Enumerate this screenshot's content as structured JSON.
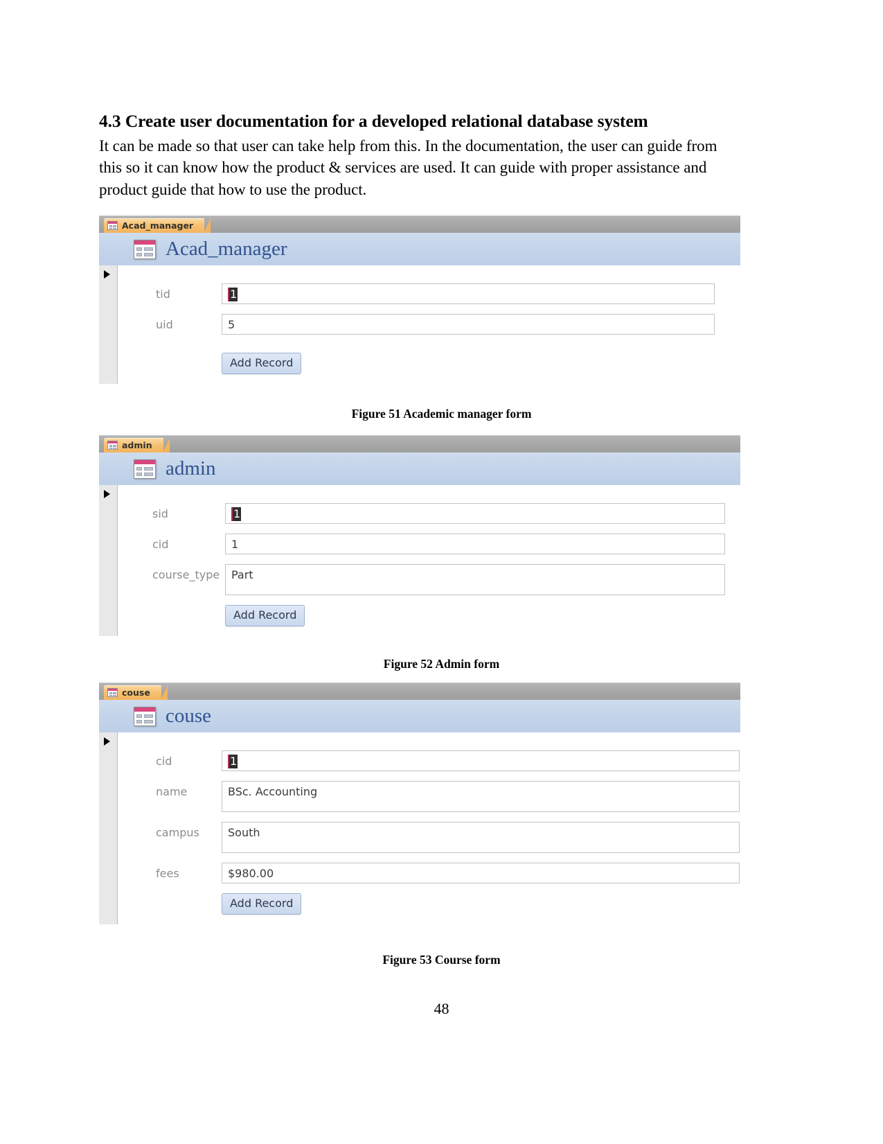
{
  "document": {
    "section_heading": "4.3 Create user documentation for a developed relational database system",
    "paragraph": "It can be made so that user can take help from this. In the documentation, the user can guide from this so it can know how the product & services are used. It can guide with proper assistance and product guide that how to use the product.",
    "page_number": "48"
  },
  "figures": [
    {
      "caption": "Figure 51 Academic manager form",
      "screenshot": {
        "tab_label": "Acad_manager",
        "tab_icon": "form-icon",
        "header_title": "Acad_manager",
        "header_icon": "form-icon",
        "record_selector_icon": "current-record-arrow-icon",
        "fields": [
          {
            "label": "tid",
            "value": "1",
            "selected": true
          },
          {
            "label": "uid",
            "value": "5",
            "selected": false
          }
        ],
        "button_label": "Add Record"
      }
    },
    {
      "caption": "Figure 52 Admin form",
      "screenshot": {
        "tab_label": "admin",
        "tab_icon": "form-icon",
        "header_title": "admin",
        "header_icon": "form-icon",
        "record_selector_icon": "current-record-arrow-icon",
        "fields": [
          {
            "label": "sid",
            "value": "1",
            "selected": true
          },
          {
            "label": "cid",
            "value": "1",
            "selected": false
          },
          {
            "label": "course_type",
            "value": "Part",
            "selected": false
          }
        ],
        "button_label": "Add Record"
      }
    },
    {
      "caption": "Figure 53 Course form",
      "screenshot": {
        "tab_label": "couse",
        "tab_icon": "form-icon",
        "header_title": "couse",
        "header_icon": "form-icon",
        "record_selector_icon": "current-record-arrow-icon",
        "fields": [
          {
            "label": "cid",
            "value": "1",
            "selected": true
          },
          {
            "label": "name",
            "value": "BSc. Accounting",
            "selected": false
          },
          {
            "label": "campus",
            "value": "South",
            "selected": false
          },
          {
            "label": "fees",
            "value": "$980.00",
            "selected": false
          }
        ],
        "button_label": "Add Record"
      }
    }
  ],
  "colors": {
    "tab_accent": "#f3b45c",
    "form_header": "#c3d4ea",
    "form_title_text": "#31538f",
    "label_text": "#8c8c8c",
    "tabstrip": "#a8a8a8"
  }
}
